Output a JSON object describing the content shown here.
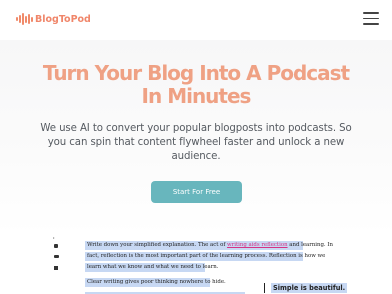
{
  "brand": {
    "name": "BlogToPod",
    "color": "#f0866a"
  },
  "nav": {
    "menu_icon": "hamburger-menu-icon"
  },
  "hero": {
    "title": "Turn Your Blog Into A Podcast\nIn Minutes",
    "subtitle": "We use AI to convert your popular blogposts into podcasts. So you can spin that content flywheel faster and unlock a new audience.",
    "cta_label": "Start For Free",
    "accent_color": "#efa184",
    "cta_color": "#68b6bd"
  },
  "editor_preview": {
    "tools": [
      "mail-icon",
      "folder-icon",
      "print-icon"
    ],
    "lines": [
      {
        "before": "Write down your simplified explanation. The act of ",
        "link": "writing aids reflection",
        "after": " and learning. In"
      },
      {
        "before": "fact, reflection is the most important part of the learning process. Reflection is how we",
        "link": "",
        "after": ""
      },
      {
        "before": "learn what we know and what we need to learn.",
        "link": "",
        "after": ""
      },
      {
        "before": "Clear writing gives poor thinking nowhere to hide.",
        "link": "",
        "after": ""
      }
    ],
    "quote": "Simple is beautiful."
  }
}
